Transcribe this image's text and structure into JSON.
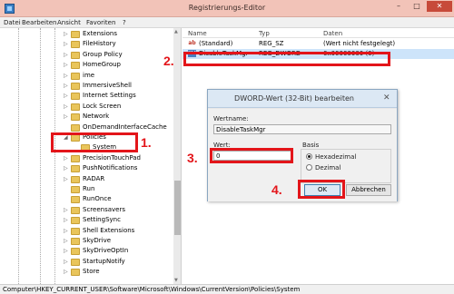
{
  "window": {
    "title": "Registrierungs-Editor",
    "min": "–",
    "max": "□",
    "close": "✕"
  },
  "menu": [
    "Datei",
    "Bearbeiten",
    "Ansicht",
    "Favoriten",
    "?"
  ],
  "tree": {
    "items": [
      {
        "label": "Extensions",
        "exp": "▷"
      },
      {
        "label": "FileHistory",
        "exp": "▷"
      },
      {
        "label": "Group Policy",
        "exp": "▷"
      },
      {
        "label": "HomeGroup",
        "exp": "▷"
      },
      {
        "label": "ime",
        "exp": "▷"
      },
      {
        "label": "ImmersiveShell",
        "exp": "▷"
      },
      {
        "label": "Internet Settings",
        "exp": "▷"
      },
      {
        "label": "Lock Screen",
        "exp": "▷"
      },
      {
        "label": "Network",
        "exp": "▷"
      },
      {
        "label": "OnDemandInterfaceCache",
        "exp": ""
      },
      {
        "label": "Policies",
        "exp": "◢"
      },
      {
        "label": "System",
        "exp": "",
        "sub": true
      },
      {
        "label": "PrecisionTouchPad",
        "exp": "▷"
      },
      {
        "label": "PushNotifications",
        "exp": "▷"
      },
      {
        "label": "RADAR",
        "exp": "▷"
      },
      {
        "label": "Run",
        "exp": ""
      },
      {
        "label": "RunOnce",
        "exp": ""
      },
      {
        "label": "Screensavers",
        "exp": "▷"
      },
      {
        "label": "SettingSync",
        "exp": "▷"
      },
      {
        "label": "Shell Extensions",
        "exp": "▷"
      },
      {
        "label": "SkyDrive",
        "exp": "▷"
      },
      {
        "label": "SkyDriveOptIn",
        "exp": "▷"
      },
      {
        "label": "StartupNotify",
        "exp": "▷"
      },
      {
        "label": "Store",
        "exp": "▷"
      }
    ]
  },
  "values": {
    "headers": [
      "Name",
      "Typ",
      "Daten"
    ],
    "rows": [
      {
        "icon": "ab",
        "name": "(Standard)",
        "type": "REG_SZ",
        "data": "(Wert nicht festgelegt)"
      },
      {
        "icon": "011",
        "name": "DisableTaskMgr",
        "type": "REG_DWORD",
        "data": "0x00000000 (0)"
      }
    ]
  },
  "status_path": "Computer\\HKEY_CURRENT_USER\\Software\\Microsoft\\Windows\\CurrentVersion\\Policies\\System",
  "dialog": {
    "title": "DWORD-Wert (32-Bit) bearbeiten",
    "close": "✕",
    "name_label": "Wertname:",
    "name_value": "DisableTaskMgr",
    "value_label": "Wert:",
    "value_value": "0",
    "base_label": "Basis",
    "radio_hex": "Hexadezimal",
    "radio_dec": "Dezimal",
    "ok": "OK",
    "cancel": "Abbrechen"
  },
  "annotations": [
    "1.",
    "2.",
    "3.",
    "4."
  ],
  "colors": {
    "highlight": "#e3151a",
    "title_bar": "#f2c3b8"
  }
}
